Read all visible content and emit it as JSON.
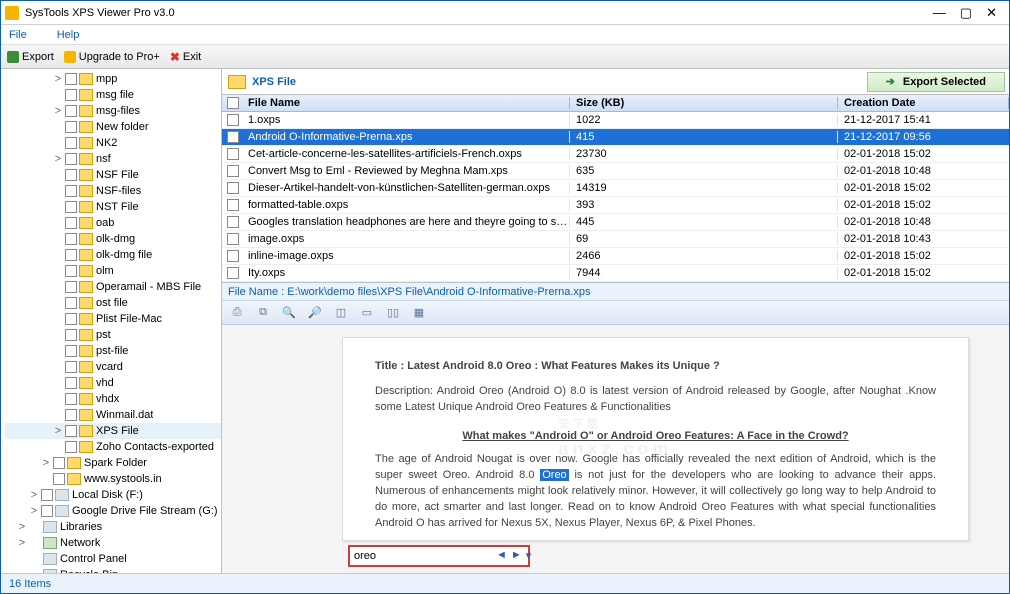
{
  "window": {
    "title": "SysTools XPS Viewer Pro v3.0",
    "controls": {
      "min": "—",
      "max": "▢",
      "close": "✕"
    }
  },
  "menu": {
    "file": "File",
    "help": "Help"
  },
  "toolbar": {
    "export": "Export",
    "upgrade": "Upgrade to Pro+",
    "exit": "Exit"
  },
  "sidebar": {
    "items": [
      {
        "d": 4,
        "exp": ">",
        "chk": true,
        "label": "mpp"
      },
      {
        "d": 4,
        "exp": "",
        "chk": true,
        "label": "msg file"
      },
      {
        "d": 4,
        "exp": ">",
        "chk": true,
        "label": "msg-files"
      },
      {
        "d": 4,
        "exp": "",
        "chk": true,
        "label": "New folder"
      },
      {
        "d": 4,
        "exp": "",
        "chk": true,
        "label": "NK2"
      },
      {
        "d": 4,
        "exp": ">",
        "chk": true,
        "label": "nsf"
      },
      {
        "d": 4,
        "exp": "",
        "chk": true,
        "label": "NSF File"
      },
      {
        "d": 4,
        "exp": "",
        "chk": true,
        "label": "NSF-files"
      },
      {
        "d": 4,
        "exp": "",
        "chk": true,
        "label": "NST File"
      },
      {
        "d": 4,
        "exp": "",
        "chk": true,
        "label": "oab"
      },
      {
        "d": 4,
        "exp": "",
        "chk": true,
        "label": "olk-dmg"
      },
      {
        "d": 4,
        "exp": "",
        "chk": true,
        "label": "olk-dmg file"
      },
      {
        "d": 4,
        "exp": "",
        "chk": true,
        "label": "olm"
      },
      {
        "d": 4,
        "exp": "",
        "chk": true,
        "label": "Operamail - MBS File"
      },
      {
        "d": 4,
        "exp": "",
        "chk": true,
        "label": "ost file"
      },
      {
        "d": 4,
        "exp": "",
        "chk": true,
        "label": "Plist File-Mac"
      },
      {
        "d": 4,
        "exp": "",
        "chk": true,
        "label": "pst"
      },
      {
        "d": 4,
        "exp": "",
        "chk": true,
        "label": "pst-file"
      },
      {
        "d": 4,
        "exp": "",
        "chk": true,
        "label": "vcard"
      },
      {
        "d": 4,
        "exp": "",
        "chk": true,
        "label": "vhd"
      },
      {
        "d": 4,
        "exp": "",
        "chk": true,
        "label": "vhdx"
      },
      {
        "d": 4,
        "exp": "",
        "chk": true,
        "label": "Winmail.dat"
      },
      {
        "d": 4,
        "exp": ">",
        "chk": true,
        "label": "XPS File",
        "selected": true
      },
      {
        "d": 4,
        "exp": "",
        "chk": true,
        "label": "Zoho Contacts-exported"
      },
      {
        "d": 3,
        "exp": ">",
        "chk": true,
        "label": "Spark Folder"
      },
      {
        "d": 3,
        "exp": "",
        "chk": true,
        "label": "www.systools.in"
      },
      {
        "d": 2,
        "exp": ">",
        "chk": true,
        "label": "Local Disk (F:)",
        "kind": "disk"
      },
      {
        "d": 2,
        "exp": ">",
        "chk": true,
        "label": "Google Drive File Stream (G:)",
        "kind": "disk"
      },
      {
        "d": 1,
        "exp": ">",
        "chk": false,
        "label": "Libraries",
        "kind": "disk"
      },
      {
        "d": 1,
        "exp": ">",
        "chk": false,
        "label": "Network",
        "kind": "net"
      },
      {
        "d": 1,
        "exp": "",
        "chk": false,
        "label": "Control Panel",
        "kind": "disk"
      },
      {
        "d": 1,
        "exp": "",
        "chk": false,
        "label": "Recycle Bin",
        "kind": "disk"
      }
    ]
  },
  "listHeader": {
    "folder": "XPS File",
    "exportSelected": "Export Selected"
  },
  "columns": {
    "name": "File Name",
    "size": "Size (KB)",
    "date": "Creation Date"
  },
  "rows": [
    {
      "name": "1.oxps",
      "size": "1022",
      "date": "21-12-2017 15:41"
    },
    {
      "name": "Android O-Informative-Prerna.xps",
      "size": "415",
      "date": "21-12-2017 09:56",
      "selected": true
    },
    {
      "name": "Cet-article-concerne-les-satellites-artificiels-French.oxps",
      "size": "23730",
      "date": "02-01-2018 15:02"
    },
    {
      "name": "Convert Msg to Eml - Reviewed by Meghna Mam.xps",
      "size": "635",
      "date": "02-01-2018 10:48"
    },
    {
      "name": "Dieser-Artikel-handelt-von-künstlichen-Satelliten-german.oxps",
      "size": "14319",
      "date": "02-01-2018 15:02"
    },
    {
      "name": "formatted-table.oxps",
      "size": "393",
      "date": "02-01-2018 15:02"
    },
    {
      "name": "Googles translation headphones are here and theyre going to start a war published…",
      "size": "445",
      "date": "02-01-2018 10:48"
    },
    {
      "name": "image.oxps",
      "size": "69",
      "date": "02-01-2018 10:43"
    },
    {
      "name": "inline-image.oxps",
      "size": "2466",
      "date": "02-01-2018 15:02"
    },
    {
      "name": "Ity.oxps",
      "size": "7944",
      "date": "02-01-2018 15:02"
    }
  ],
  "pathbar": "File Name : E:\\work\\demo files\\XPS File\\Android O-Informative-Prerna.xps",
  "preview": {
    "title": "Title : Latest Android 8.0 Oreo : What Features Makes its Unique ?",
    "desc": "Description: Android Oreo (Android O) 8.0 is latest version of Android released by Google, after Noughat .Know some Latest Unique Android Oreo Features & Functionalities",
    "heading": "What makes \"Android O\" or Android Oreo Features: A Face in the Crowd?",
    "body_pre": "The age of Android Nougat is over now.  Google has officially revealed the next edition of Android, which is the super sweet Oreo. Android 8.0 ",
    "body_hl": "Oreo",
    "body_post": " is not just for the developers who are looking to advance their apps. Numerous of enhancements might look relatively minor. However, it will collectively go long way to help Android to do more, act smarter and last longer.  Read on to know Android Oreo Features with what special functionalities Android O has arrived for Nexus 5X, Nexus Player, Nexus 6P, & Pixel Phones."
  },
  "search": {
    "value": "oreo"
  },
  "status": {
    "count": "16 Items"
  },
  "watermark": {
    "main": "安下载",
    "sub": "anxz.com"
  }
}
